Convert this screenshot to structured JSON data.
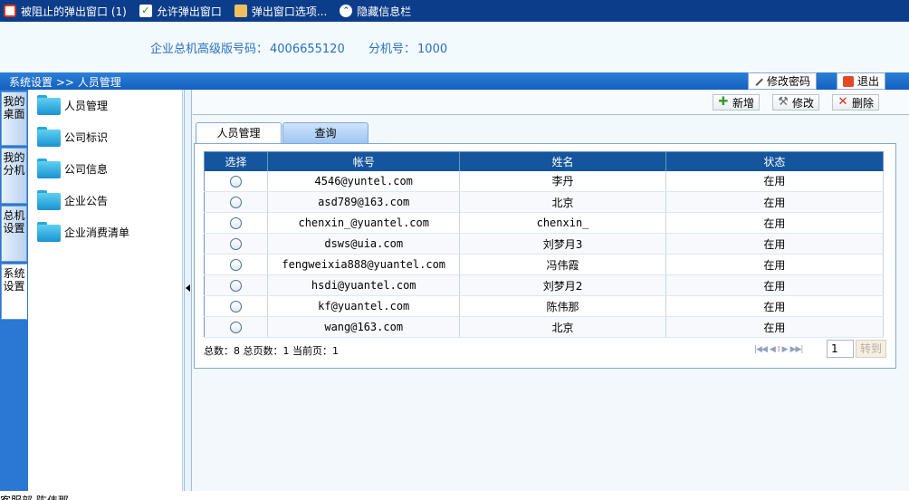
{
  "infobar": {
    "items": [
      {
        "label": "被阻止的弹出窗口  (1)",
        "icon": "blocked-popup-icon"
      },
      {
        "label": "允许弹出窗口",
        "icon": "allow-popup-icon"
      },
      {
        "label": "弹出窗口选项...",
        "icon": "popup-options-icon"
      },
      {
        "label": "隐藏信息栏",
        "icon": "hide-bar-icon"
      }
    ]
  },
  "header": {
    "hotline_label": "企业总机高级版号码：",
    "hotline_number": "4006655120",
    "ext_label": "分机号：",
    "ext_number": "1000"
  },
  "navbar": {
    "breadcrumb": "系统设置 >> 人员管理",
    "change_password": "修改密码",
    "logout": "退出"
  },
  "left_tabs": [
    {
      "label": "我的桌面"
    },
    {
      "label": "我的分机"
    },
    {
      "label": "总机设置"
    },
    {
      "label": "系统设置"
    }
  ],
  "menu": {
    "items": [
      {
        "label": "人员管理"
      },
      {
        "label": "公司标识"
      },
      {
        "label": "公司信息"
      },
      {
        "label": "企业公告"
      },
      {
        "label": "企业消费清单"
      }
    ]
  },
  "toolbar": {
    "add": "新增",
    "edit": "修改",
    "delete": "删除"
  },
  "tabs": [
    {
      "label": "人员管理"
    },
    {
      "label": "查询"
    }
  ],
  "table": {
    "headers": [
      "选择",
      "帐号",
      "姓名",
      "状态"
    ],
    "rows": [
      {
        "account": "4546@yuntel.com",
        "name": "李丹",
        "status": "在用"
      },
      {
        "account": "asd789@163.com",
        "name": "北京",
        "status": "在用"
      },
      {
        "account": "chenxin_@yuantel.com",
        "name": "chenxin_",
        "status": "在用"
      },
      {
        "account": "dsws@uia.com",
        "name": "刘梦月3",
        "status": "在用"
      },
      {
        "account": "fengweixia888@yuantel.com",
        "name": "冯伟霞",
        "status": "在用"
      },
      {
        "account": "hsdi@yuantel.com",
        "name": "刘梦月2",
        "status": "在用"
      },
      {
        "account": "kf@yuantel.com",
        "name": "陈伟那",
        "status": "在用"
      },
      {
        "account": "wang@163.com",
        "name": "北京",
        "status": "在用"
      }
    ]
  },
  "footer": {
    "summary": "总数：8  总页数：1  当前页：1",
    "page_value": "1",
    "go_label": "转到"
  },
  "statusbar": {
    "text": "客服部  陈伟那"
  }
}
